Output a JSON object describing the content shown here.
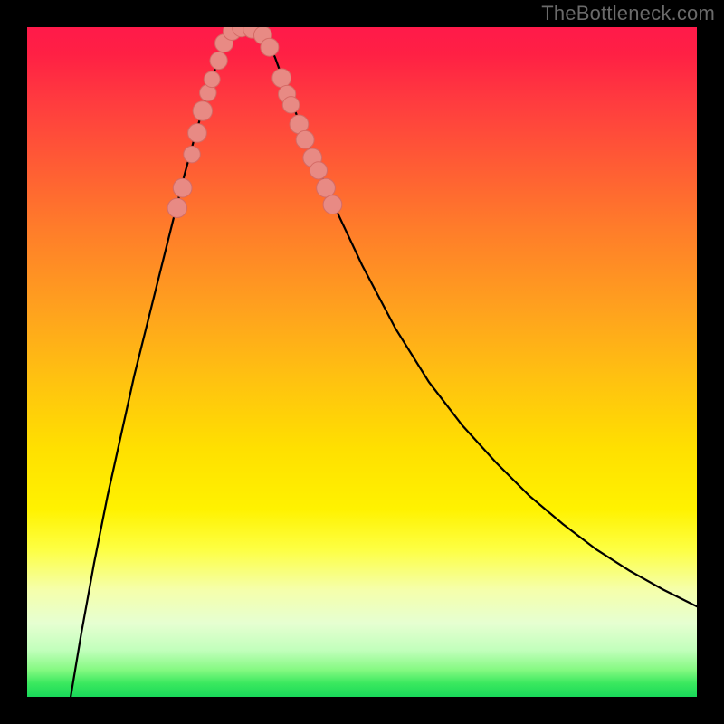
{
  "attribution": "TheBottleneck.com",
  "colors": {
    "curve": "#000000",
    "marker_fill": "#e88a84",
    "marker_stroke": "#d46b66",
    "frame": "#000000"
  },
  "chart_data": {
    "type": "line",
    "title": "",
    "xlabel": "",
    "ylabel": "",
    "xlim": [
      0,
      100
    ],
    "ylim": [
      0,
      100
    ],
    "series": [
      {
        "name": "left-branch",
        "x": [
          6.5,
          8,
          10,
          12,
          14,
          16,
          18,
          20,
          22,
          23.5,
          25,
          26,
          27,
          28,
          29,
          29.8
        ],
        "y": [
          0,
          9,
          20,
          30,
          39,
          48,
          56,
          64,
          72,
          78,
          83.5,
          87,
          90.5,
          93.5,
          96.5,
          98.5
        ]
      },
      {
        "name": "v-bottom",
        "x": [
          29.8,
          30.5,
          31.5,
          33.0,
          34.5,
          35.8
        ],
        "y": [
          98.5,
          99.4,
          99.8,
          99.8,
          99.3,
          98.2
        ]
      },
      {
        "name": "right-branch",
        "x": [
          35.8,
          37,
          39,
          41,
          43,
          46,
          50,
          55,
          60,
          65,
          70,
          75,
          80,
          85,
          90,
          95,
          100
        ],
        "y": [
          98.2,
          95.5,
          90,
          85,
          80,
          73,
          64.5,
          55,
          47,
          40.5,
          35,
          30,
          25.8,
          22,
          18.8,
          16,
          13.5
        ]
      }
    ],
    "markers": [
      {
        "x": 22.4,
        "y": 73.0,
        "r": 1.45
      },
      {
        "x": 23.2,
        "y": 76.0,
        "r": 1.4
      },
      {
        "x": 24.6,
        "y": 81.0,
        "r": 1.25
      },
      {
        "x": 25.4,
        "y": 84.2,
        "r": 1.4
      },
      {
        "x": 26.2,
        "y": 87.5,
        "r": 1.45
      },
      {
        "x": 27.0,
        "y": 90.2,
        "r": 1.25
      },
      {
        "x": 27.6,
        "y": 92.2,
        "r": 1.2
      },
      {
        "x": 28.6,
        "y": 95.0,
        "r": 1.3
      },
      {
        "x": 29.4,
        "y": 97.6,
        "r": 1.35
      },
      {
        "x": 30.6,
        "y": 99.4,
        "r": 1.35
      },
      {
        "x": 32.0,
        "y": 99.9,
        "r": 1.35
      },
      {
        "x": 33.6,
        "y": 99.7,
        "r": 1.35
      },
      {
        "x": 35.2,
        "y": 98.8,
        "r": 1.35
      },
      {
        "x": 36.2,
        "y": 97.0,
        "r": 1.35
      },
      {
        "x": 38.0,
        "y": 92.4,
        "r": 1.4
      },
      {
        "x": 38.8,
        "y": 90.0,
        "r": 1.3
      },
      {
        "x": 39.4,
        "y": 88.4,
        "r": 1.25
      },
      {
        "x": 40.6,
        "y": 85.5,
        "r": 1.4
      },
      {
        "x": 41.5,
        "y": 83.2,
        "r": 1.35
      },
      {
        "x": 42.6,
        "y": 80.5,
        "r": 1.4
      },
      {
        "x": 43.5,
        "y": 78.6,
        "r": 1.3
      },
      {
        "x": 44.6,
        "y": 76.0,
        "r": 1.4
      },
      {
        "x": 45.6,
        "y": 73.5,
        "r": 1.4
      }
    ]
  }
}
